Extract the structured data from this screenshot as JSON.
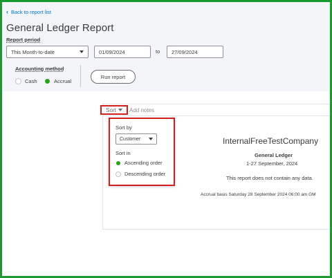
{
  "header": {
    "back_link": "Back to report list",
    "title": "General Ledger Report"
  },
  "filters": {
    "report_period_label": "Report period",
    "period_value": "This Month-to-date",
    "date_from": "01/09/2024",
    "to_label": "to",
    "date_to": "27/09/2024",
    "accounting_method_label": "Accounting method",
    "method_options": [
      "Cash",
      "Accrual"
    ],
    "method_selected": "Accrual",
    "run_report_label": "Run report"
  },
  "toolbar": {
    "sort_label": "Sort",
    "add_notes_label": "Add notes"
  },
  "sort_popup": {
    "sort_by_label": "Sort by",
    "sort_by_value": "Customer",
    "sort_in_label": "Sort in",
    "options": [
      "Ascending order",
      "Descending order"
    ],
    "selected": "Ascending order"
  },
  "report": {
    "company": "InternalFreeTestCompany",
    "name": "General Ledger",
    "dates": "1-27 September, 2024",
    "no_data_message": "This report does not contain any data.",
    "basis_line": "Accrual basis  Saturday 28 September 2024  06:00 am GM"
  },
  "colors": {
    "accent_green": "#2ca01c",
    "link_blue": "#0077c5",
    "highlight_red": "#d31e1e",
    "frame_green": "#1a9a2c"
  }
}
